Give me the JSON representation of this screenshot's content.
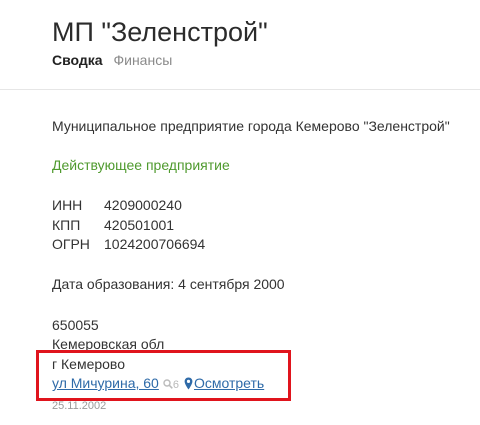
{
  "header": {
    "title": "МП \"Зеленстрой\"",
    "tabs": [
      {
        "label": "Сводка",
        "active": true
      },
      {
        "label": "Финансы",
        "active": false
      }
    ]
  },
  "company": {
    "full_name": "Муниципальное предприятие города Кемерово \"Зеленстрой\"",
    "status": "Действующее предприятие",
    "status_color": "#4f9a2e",
    "ids": [
      {
        "key": "ИНН",
        "value": "4209000240"
      },
      {
        "key": "КПП",
        "value": "420501001"
      },
      {
        "key": "ОГРН",
        "value": "1024200706694"
      }
    ],
    "founded": "Дата образования: 4 сентября 2000"
  },
  "address": {
    "zip": "650055",
    "region": "Кемеровская обл",
    "city": "г Кемерово",
    "street": "ул Мичурина, 60",
    "search_count": "6",
    "view_label": "Осмотреть",
    "date": "25.11.2002",
    "link_color": "#2e6aa8",
    "icons": [
      "search-icon",
      "map-pin-icon"
    ]
  },
  "annotation": {
    "highlight_color": "#e0141d"
  }
}
